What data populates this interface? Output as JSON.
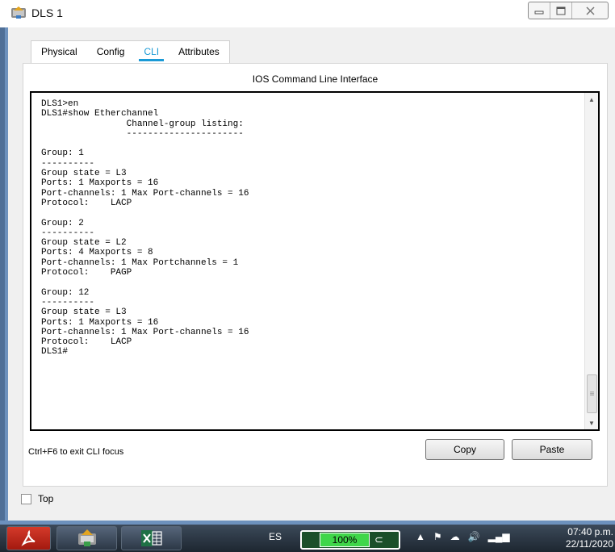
{
  "window": {
    "title": "DLS 1",
    "controls": [
      "minimize",
      "maximize",
      "close"
    ]
  },
  "tabs": [
    {
      "label": "Physical",
      "active": false
    },
    {
      "label": "Config",
      "active": false
    },
    {
      "label": "CLI",
      "active": true
    },
    {
      "label": "Attributes",
      "active": false
    }
  ],
  "cli": {
    "header": "IOS Command Line Interface",
    "lines": [
      "DLS1>en",
      "DLS1#show Etherchannel",
      "                Channel-group listing:",
      "                ----------------------",
      "",
      "Group: 1",
      "----------",
      "Group state = L3",
      "Ports: 1 Maxports = 16",
      "Port-channels: 1 Max Port-channels = 16",
      "Protocol:    LACP",
      "",
      "Group: 2",
      "----------",
      "Group state = L2",
      "Ports: 4 Maxports = 8",
      "Port-channels: 1 Max Portchannels = 1",
      "Protocol:    PAGP",
      "",
      "Group: 12",
      "----------",
      "Group state = L3",
      "Ports: 1 Maxports = 16",
      "Port-channels: 1 Max Port-channels = 16",
      "Protocol:    LACP",
      "DLS1#"
    ],
    "hint": "Ctrl+F6 to exit CLI focus",
    "copy_label": "Copy",
    "paste_label": "Paste"
  },
  "options": {
    "top_label": "Top",
    "top_checked": false
  },
  "taskbar": {
    "language": "ES",
    "battery": "100%",
    "time": "07:40 p.m.",
    "date": "22/11/2020"
  },
  "colors": {
    "accent": "#1a9ad6",
    "frame": "#6d91bd",
    "battery_fill": "#3fd64a"
  }
}
